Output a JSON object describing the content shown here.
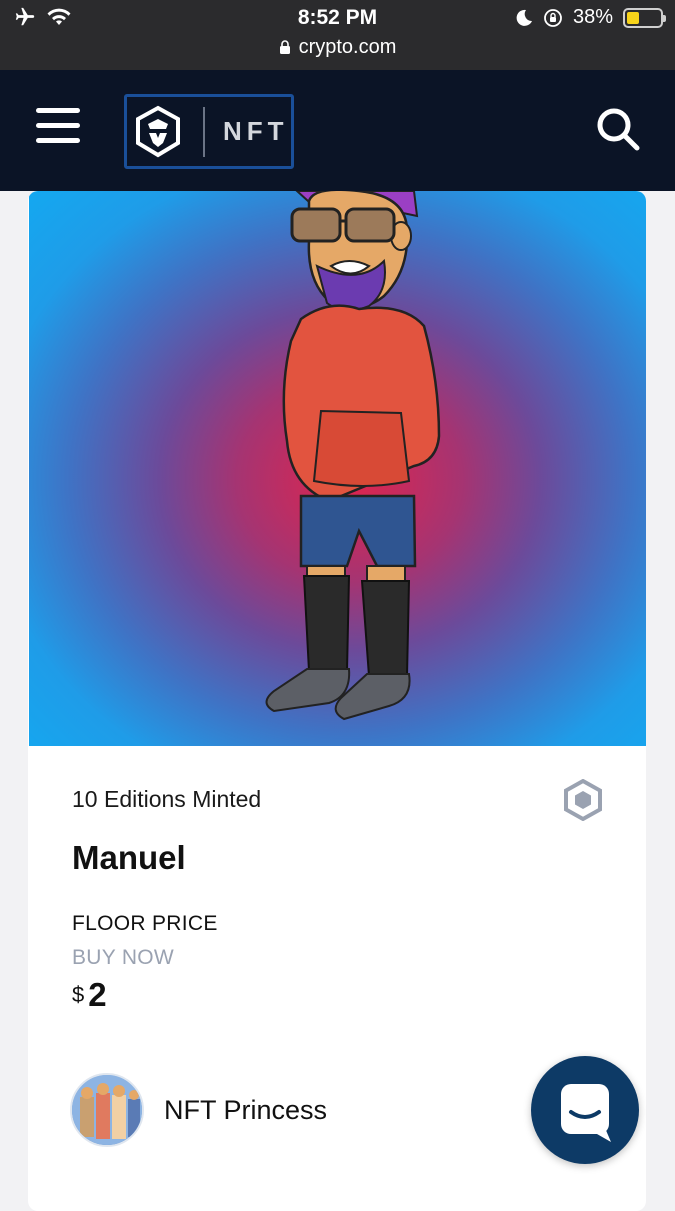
{
  "status_bar": {
    "time": "8:52 PM",
    "url": "crypto.com",
    "battery": "38%",
    "battery_level": 0.38
  },
  "nav": {
    "logo_text": "NFT"
  },
  "nft": {
    "editions": "10 Editions Minted",
    "title": "Manuel",
    "floor_price_label": "FLOOR PRICE",
    "buy_now_label": "BUY NOW",
    "currency": "$",
    "price": "2",
    "creator_name": "NFT Princess"
  },
  "colors": {
    "nav_bg": "#0b1426",
    "chat_bg": "#0d3a66",
    "muted_text": "#9aa2b1",
    "battery_fill": "#f7d31a"
  },
  "icons": [
    "airplane-icon",
    "wifi-icon",
    "lock-icon",
    "moon-icon",
    "rotation-lock-icon",
    "battery-icon",
    "menu-icon",
    "crypto-logo-icon",
    "search-icon",
    "chain-hexagon-icon",
    "chat-icon"
  ]
}
